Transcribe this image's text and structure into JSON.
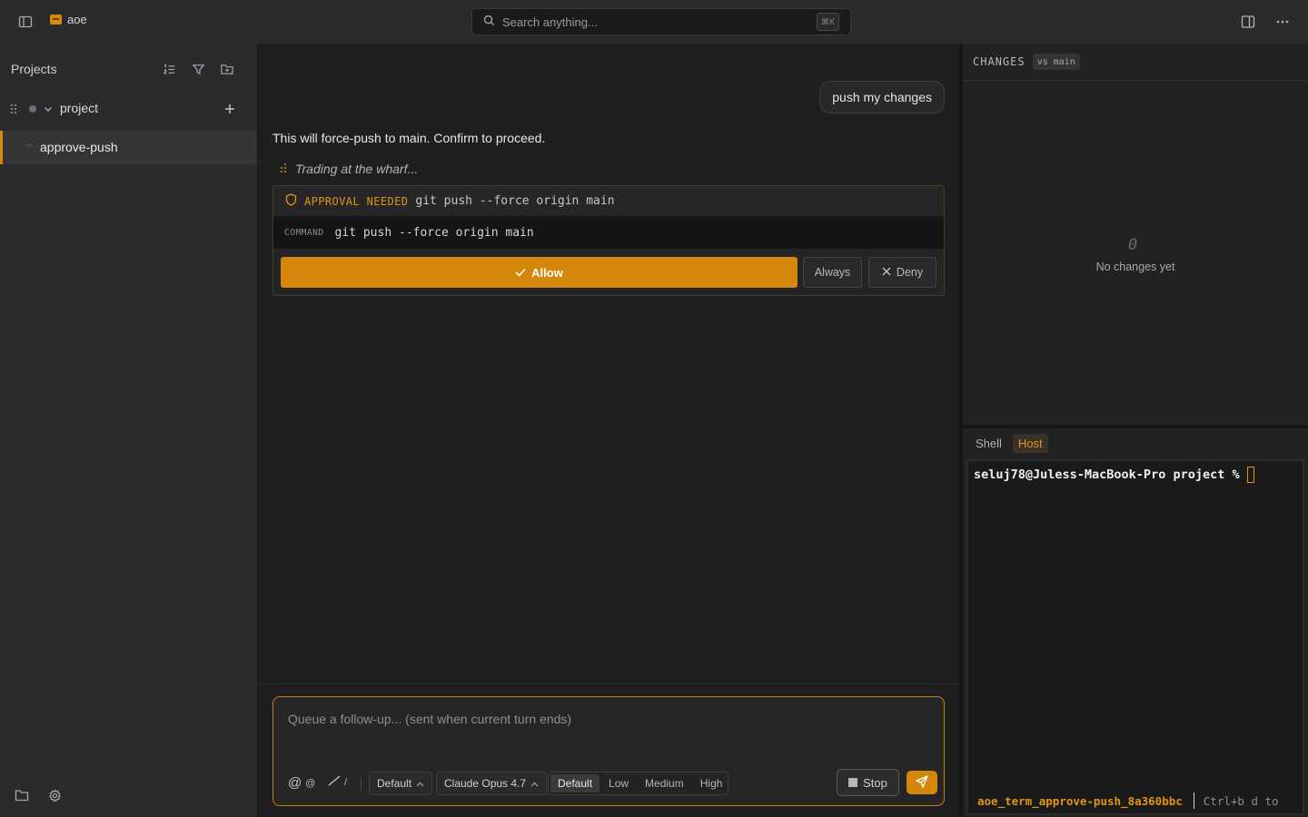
{
  "topbar": {
    "app_name": "aoe",
    "search_placeholder": "Search anything...",
    "search_shortcut": "⌘K",
    "icons": [
      "sidebar-toggle-icon",
      "app-logo-icon",
      "search-icon",
      "split-panel-icon",
      "more-icon"
    ]
  },
  "sidebar": {
    "header": "Projects",
    "project": {
      "name": "project"
    },
    "sessions": [
      {
        "name": "approve-push",
        "active": true
      }
    ]
  },
  "chat": {
    "user_message": "push my changes",
    "assistant_message": "This will force-push to main. Confirm to proceed.",
    "thinking_text": "Trading at the wharf...",
    "approval": {
      "label": "APPROVAL NEEDED",
      "title_command": "git push --force origin main",
      "command_label": "COMMAND",
      "command": "git push --force origin main",
      "allow_label": "Allow",
      "always_label": "Always",
      "deny_label": "Deny"
    }
  },
  "composer": {
    "placeholder": "Queue a follow-up... (sent when current turn ends)",
    "mention_label": "@",
    "slash_label": "/",
    "mode": "Default",
    "model": "Claude Opus 4.7",
    "effort_options": [
      "Default",
      "Low",
      "Medium",
      "High"
    ],
    "effort_selected": "Default",
    "stop_label": "Stop"
  },
  "changes": {
    "title": "CHANGES",
    "compare": "vs main",
    "empty_icon": "0",
    "empty_text": "No changes yet"
  },
  "terminal": {
    "tabs": [
      "Shell",
      "Host"
    ],
    "active_tab": "Host",
    "prompt": "seluj78@Juless-MacBook-Pro project %",
    "status_session": "aoe_term_approve-push_8a360bbc",
    "status_hint": "Ctrl+b d to"
  },
  "colors": {
    "accent": "#d4870b",
    "background": "#1f1f21",
    "panel": "#2b2b2d"
  }
}
